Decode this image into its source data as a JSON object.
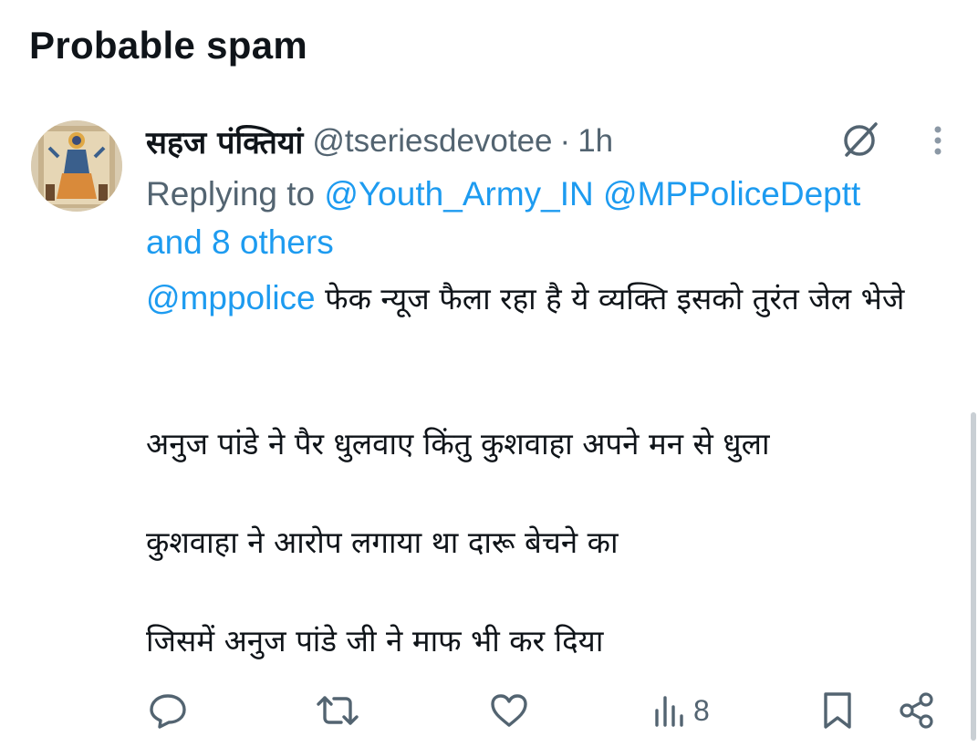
{
  "section": {
    "title": "Probable spam"
  },
  "tweet": {
    "display_name": "सहज पंक्तियां",
    "handle": "@tseriesdevotee",
    "separator": "·",
    "time": "1h",
    "replying_prefix": "Replying to",
    "replying_users": [
      "@Youth_Army_IN",
      "@MPPoliceDeptt"
    ],
    "replying_suffix": "and 8 others",
    "mention": "@mppolice",
    "paragraph_1_rest": "फेक न्यूज फैला रहा है ये व्यक्ति इसको तुरंत जेल भेजे",
    "paragraph_2": "अनुज पांडे ने पैर धुलवाए किंतु कुशवाहा अपने मन से धुला",
    "paragraph_3": "कुशवाहा ने आरोप लगाया था दारू बेचने का",
    "paragraph_4": "जिसमें अनुज पांडे जी ने माफ भी कर दिया"
  },
  "actions": {
    "views": "8"
  },
  "colors": {
    "text": "#0f1419",
    "secondary": "#536471",
    "link": "#1d9bf0"
  },
  "icons": [
    "grok-icon",
    "more-options-icon",
    "reply-icon",
    "retweet-icon",
    "like-icon",
    "views-icon",
    "bookmark-icon",
    "share-icon"
  ]
}
